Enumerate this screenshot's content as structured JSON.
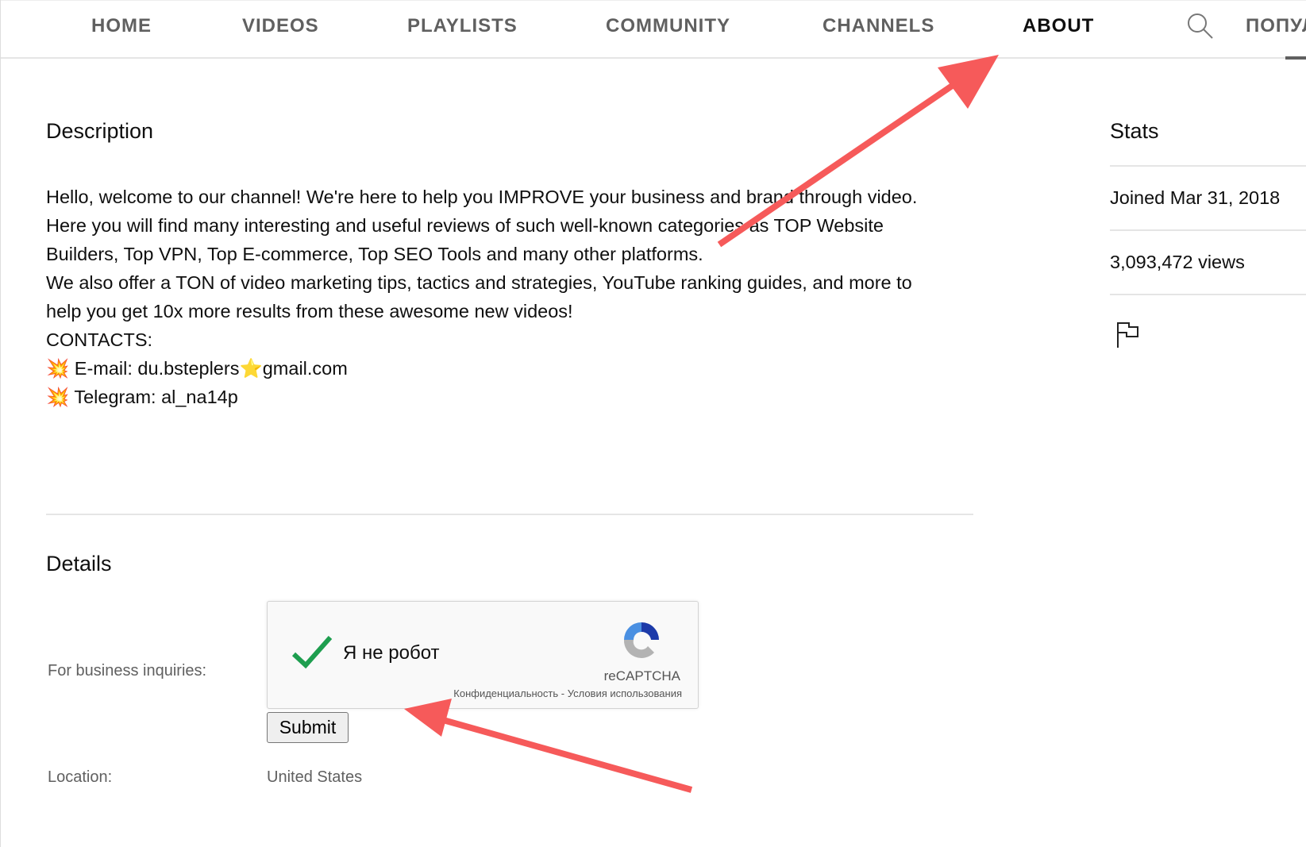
{
  "nav": {
    "tabs": [
      "HOME",
      "VIDEOS",
      "PLAYLISTS",
      "COMMUNITY",
      "CHANNELS",
      "ABOUT"
    ],
    "active": "ABOUT",
    "overflow_tab": "ПОПУЛ"
  },
  "description": {
    "heading": "Description",
    "text": "Hello, welcome to our channel!  We're here to help you IMPROVE your business and brand through video.\nHere you will find many interesting and useful reviews of such well-known categories as TOP Website\nBuilders, Top VPN, Top E-commerce, Top SEO Tools and many other platforms.\nWe also offer a TON of video marketing tips, tactics and strategies, YouTube ranking guides, and more to\nhelp you get 10x more results from these awesome new videos!\nCONTACTS:",
    "email_prefix": "💥 E-mail: du.bsteplers",
    "email_star": "⭐",
    "email_suffix": "gmail.com",
    "telegram": "💥 Telegram: al_na14p"
  },
  "details": {
    "heading": "Details",
    "business_label": "For business inquiries:",
    "captcha": {
      "label": "Я не робот",
      "brand": "reCAPTCHA",
      "privacy": "Конфиденциальность",
      "separator": " - ",
      "terms": "Условия использования"
    },
    "submit_label": "Submit",
    "location_label": "Location:",
    "location_value": "United States"
  },
  "stats": {
    "heading": "Stats",
    "joined": "Joined Mar 31, 2018",
    "views": "3,093,472 views"
  },
  "colors": {
    "arrow": "#f65a5a",
    "check": "#1e9e4f"
  }
}
